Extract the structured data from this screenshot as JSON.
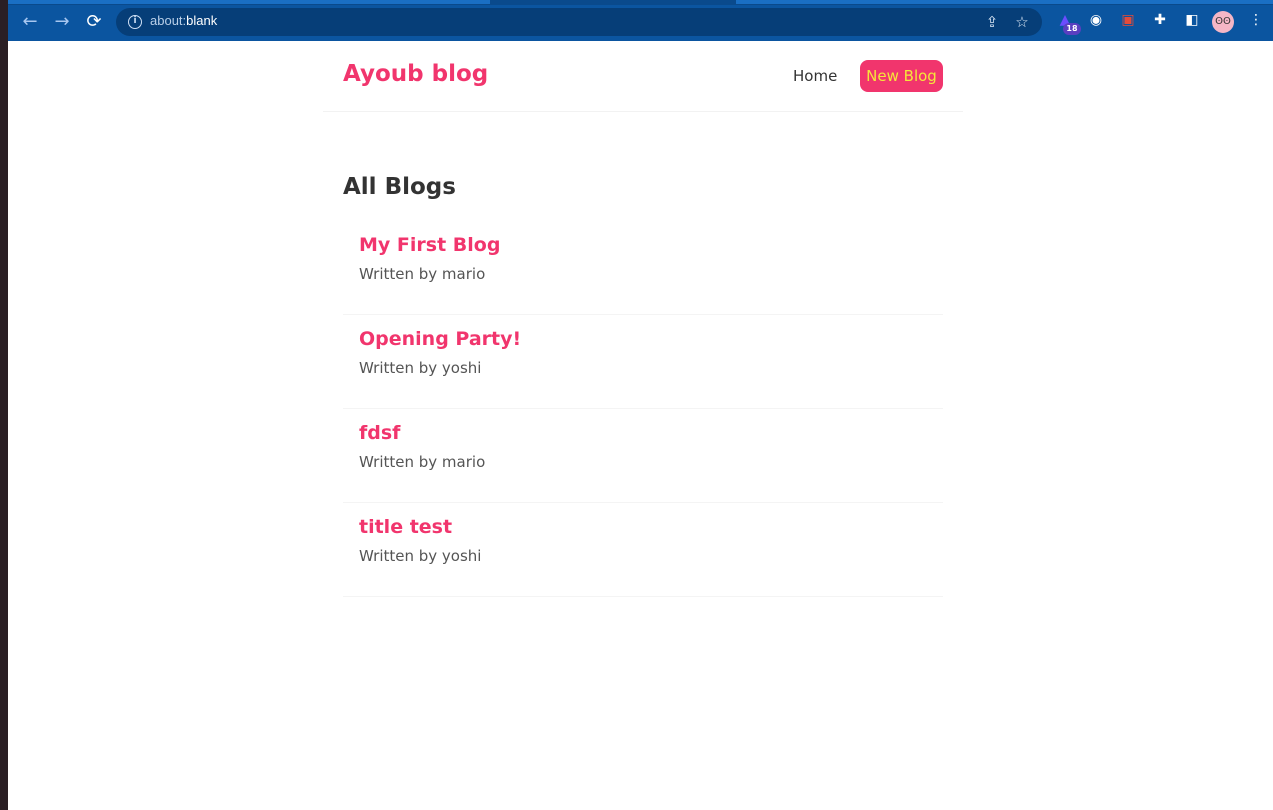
{
  "browser": {
    "url_prefix": "about:",
    "url_main": "blank",
    "extension_badge": "18",
    "avatar_glyph": "ʘʘ"
  },
  "navbar": {
    "brand": "Ayoub blog",
    "links": [
      "Home",
      "New Blog"
    ]
  },
  "main": {
    "title": "All Blogs",
    "blogs": [
      {
        "title": "My First Blog",
        "author": "Written by mario"
      },
      {
        "title": "Opening Party!",
        "author": "Written by yoshi"
      },
      {
        "title": "fdsf",
        "author": "Written by mario"
      },
      {
        "title": "title test",
        "author": "Written by yoshi"
      }
    ]
  },
  "colors": {
    "accent": "#f1356d",
    "new_blog_text": "#f5e63a",
    "chrome": "#0b55a0"
  }
}
